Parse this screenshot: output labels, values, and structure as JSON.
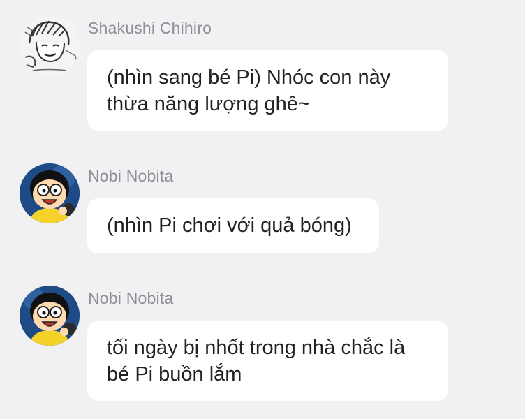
{
  "messages": [
    {
      "sender": "Shakushi Chihiro",
      "avatar_icon": "sketch-portrait-avatar",
      "lines": [
        "(nhìn sang bé Pi) Nhóc con này",
        "thừa năng lượng ghê~"
      ]
    },
    {
      "sender": "Nobi Nobita",
      "avatar_icon": "nobita-avatar",
      "lines": [
        "(nhìn Pi chơi với quả bóng)"
      ]
    },
    {
      "sender": "Nobi Nobita",
      "avatar_icon": "nobita-avatar",
      "lines": [
        "tối ngày bị nhốt trong nhà chắc là",
        "bé Pi buồn lắm"
      ]
    }
  ],
  "colors": {
    "background": "#f1f1f3",
    "bubble": "#ffffff",
    "sender_text": "#8e8e93",
    "message_text": "#222226"
  }
}
